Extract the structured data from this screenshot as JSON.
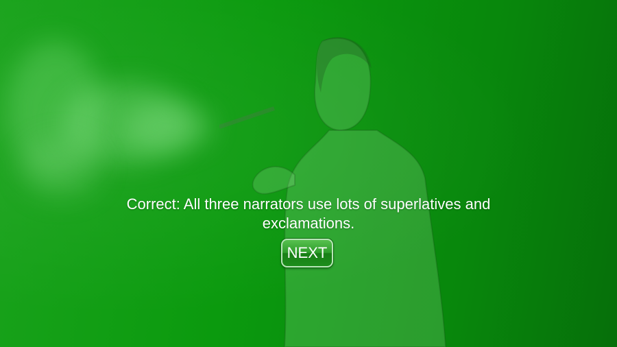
{
  "feedback": {
    "message": "Correct: All three narrators use lots of superlatives and exclamations."
  },
  "navigation": {
    "next_label": "NEXT"
  },
  "colors": {
    "background": "#0b9a0e",
    "button": "#2f9e2c",
    "text": "#ffffff"
  }
}
